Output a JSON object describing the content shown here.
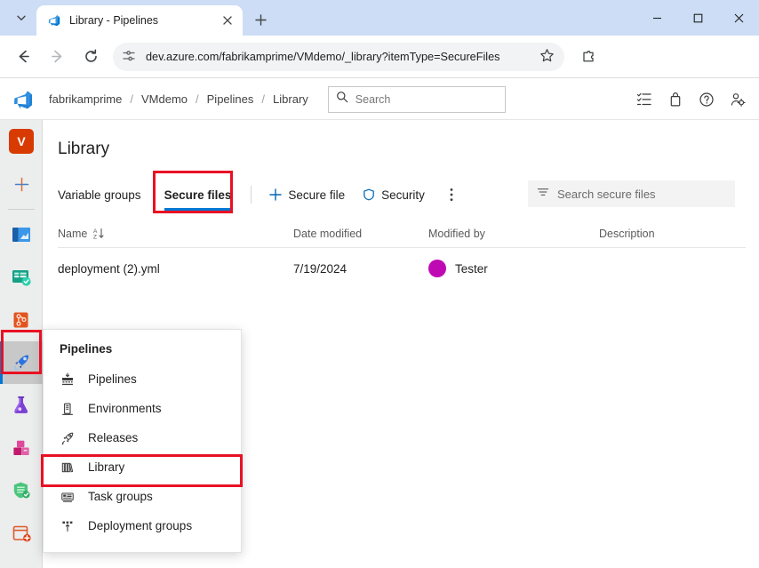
{
  "browser": {
    "tab": {
      "title": "Library - Pipelines",
      "favicon": "azure-devops-icon",
      "close_icon": "close-icon"
    },
    "tab_list_chevron": "chevron-down-icon",
    "new_tab": "plus-icon",
    "window_controls": {
      "minimize": "minimize-icon",
      "maximize": "maximize-icon",
      "close": "close-icon"
    },
    "nav": {
      "back": "back-arrow-icon",
      "forward": "forward-arrow-icon",
      "reload": "reload-icon"
    },
    "omnibox": {
      "site_info_icon": "page-settings-icon",
      "url": "dev.azure.com/fabrikamprime/VMdemo/_library?itemType=SecureFiles",
      "bookmark_icon": "star-icon"
    },
    "extensions_icon": "extensions-puzzle-icon"
  },
  "header": {
    "logo": "azure-devops-logo",
    "breadcrumb": [
      {
        "label": "fabrikamprime"
      },
      {
        "label": "VMdemo"
      },
      {
        "label": "Pipelines"
      },
      {
        "label": "Library"
      }
    ],
    "separator": "/",
    "search": {
      "placeholder": "Search",
      "icon": "search-icon"
    },
    "icons": [
      {
        "name": "boards-checklist-icon"
      },
      {
        "name": "marketplace-bag-icon"
      },
      {
        "name": "help-question-icon"
      },
      {
        "name": "user-settings-icon"
      }
    ]
  },
  "rail": {
    "project_initial": "V",
    "items": [
      {
        "name": "create-new-icon",
        "label": "Create new"
      },
      {
        "name": "overview-icon",
        "label": "Overview"
      },
      {
        "name": "boards-icon",
        "label": "Boards"
      },
      {
        "name": "repos-icon",
        "label": "Repos"
      },
      {
        "name": "pipelines-icon",
        "label": "Pipelines",
        "selected": true
      },
      {
        "name": "test-plans-icon",
        "label": "Test Plans"
      },
      {
        "name": "artifacts-icon",
        "label": "Artifacts"
      },
      {
        "name": "advanced-security-icon",
        "label": "Advanced Security"
      },
      {
        "name": "add-extension-icon",
        "label": "Add extension"
      }
    ]
  },
  "main": {
    "title": "Library",
    "pivots": [
      {
        "label": "Variable groups",
        "active": false
      },
      {
        "label": "Secure files",
        "active": true
      }
    ],
    "commands": [
      {
        "label": "Secure file",
        "icon": "plus-icon"
      },
      {
        "label": "Security",
        "icon": "shield-icon"
      }
    ],
    "more_icon": "more-vertical-icon",
    "filter": {
      "placeholder": "Search secure files",
      "icon": "filter-icon"
    },
    "table": {
      "columns": [
        "Name",
        "Date modified",
        "Modified by",
        "Description"
      ],
      "sort_icon": "sort-ascending-icon",
      "rows": [
        {
          "name": "deployment (2).yml",
          "date_modified": "7/19/2024",
          "modified_by": "Tester",
          "avatar_color": "#bf0ab4",
          "description": ""
        }
      ]
    }
  },
  "flyout": {
    "title": "Pipelines",
    "items": [
      {
        "label": "Pipelines",
        "icon": "pipelines-icon"
      },
      {
        "label": "Environments",
        "icon": "environments-icon"
      },
      {
        "label": "Releases",
        "icon": "releases-rocket-icon"
      },
      {
        "label": "Library",
        "icon": "library-books-icon",
        "highlighted": true
      },
      {
        "label": "Task groups",
        "icon": "task-groups-icon"
      },
      {
        "label": "Deployment groups",
        "icon": "deployment-groups-icon"
      }
    ]
  },
  "annotations": {
    "highlight_color": "#e81123",
    "boxes": [
      "secure-files-tab",
      "library-menu-item",
      "pipelines-rail-icon"
    ]
  }
}
